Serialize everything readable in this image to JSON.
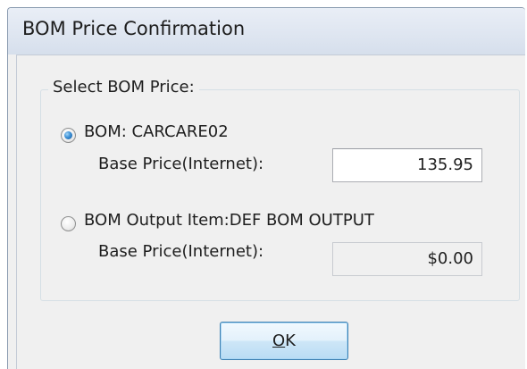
{
  "window": {
    "title": "BOM Price Confirmation"
  },
  "group": {
    "title": "Select BOM Price:"
  },
  "option1": {
    "label": "BOM: CARCARE02",
    "selected": true,
    "price_label": "Base Price(Internet):",
    "price_value": "135.95"
  },
  "option2": {
    "label": "BOM Output Item:DEF BOM OUTPUT",
    "selected": false,
    "price_label": "Base Price(Internet):",
    "price_value": "$0.00"
  },
  "buttons": {
    "ok_label": "OK",
    "ok_mnemonic": "O",
    "ok_rest": "K"
  }
}
